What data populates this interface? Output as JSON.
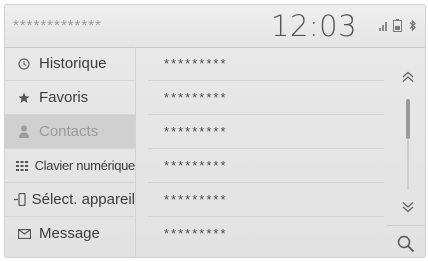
{
  "header": {
    "device_name": "*************",
    "clock": "12:03",
    "status_icons": [
      "signal-icon",
      "battery-icon",
      "bluetooth-icon"
    ]
  },
  "sidebar": {
    "items": [
      {
        "label": "Historique",
        "icon": "clock-icon",
        "active": false
      },
      {
        "label": "Favoris",
        "icon": "star-icon",
        "active": false
      },
      {
        "label": "Contacts",
        "icon": "person-icon",
        "active": true
      },
      {
        "label": "Clavier numérique",
        "icon": "keypad-icon",
        "active": false
      },
      {
        "label": "Sélect. appareil",
        "icon": "phone-icon",
        "active": false
      },
      {
        "label": "Message",
        "icon": "envelope-icon",
        "active": false
      }
    ]
  },
  "contacts": {
    "rows": [
      "*********",
      "*********",
      "*********",
      "*********",
      "*********",
      "*********"
    ]
  },
  "scroll": {
    "up_icon": "double-chevron-up-icon",
    "down_icon": "double-chevron-down-icon",
    "search_icon": "search-icon"
  },
  "colors": {
    "background": "#e6e6e6",
    "active_item": "#d0d0d0",
    "text": "#3c3c3c"
  }
}
